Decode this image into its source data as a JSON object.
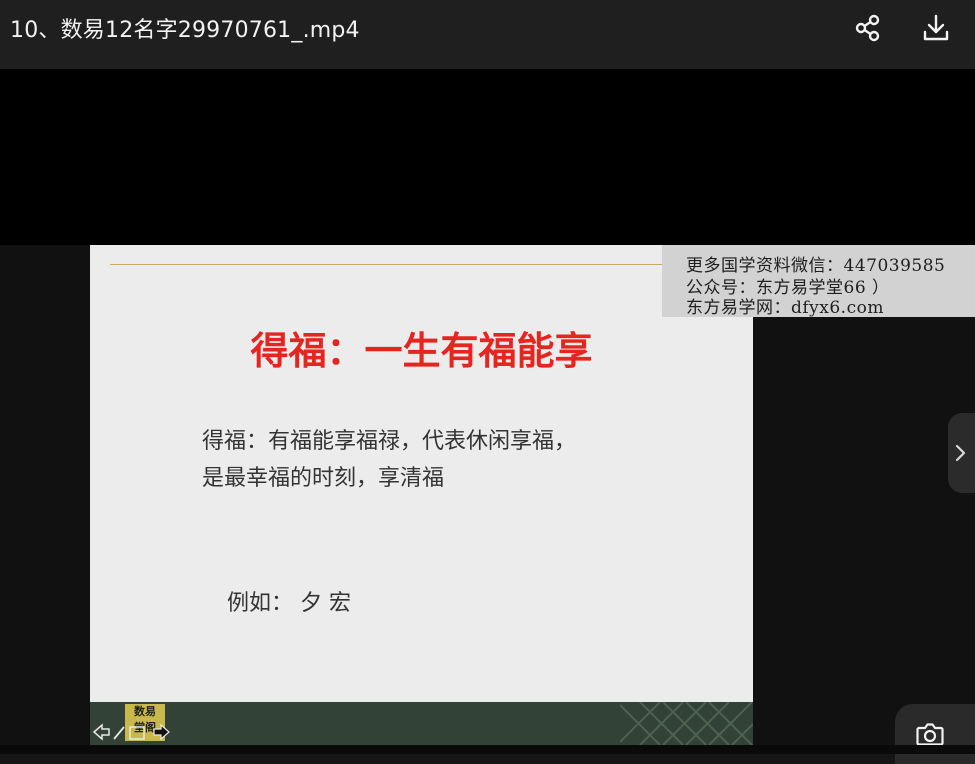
{
  "header": {
    "title": "10、数易12名字29970761_.mp4",
    "share_icon": "share-icon",
    "download_icon": "download-icon"
  },
  "slide": {
    "title": "得福：一生有福能享",
    "body_line1": "得福：有福能享福禄，代表休闲享福，",
    "body_line2": "是最幸福的时刻，享清福",
    "example": "例如：  夕    宏",
    "footer_logo": "数易",
    "footer_logo_sub": "堂阁"
  },
  "watermark": {
    "line1": "更多国学资料微信：447039585",
    "line2": "公众号：东方易学堂66 ）",
    "line3": "东方易学网：dfyx6.com"
  },
  "controls": {
    "next_icon": "chevron-right-icon",
    "camera_icon": "camera-icon"
  },
  "colors": {
    "title_red": "#e5251f",
    "footer_green": "#334236"
  }
}
